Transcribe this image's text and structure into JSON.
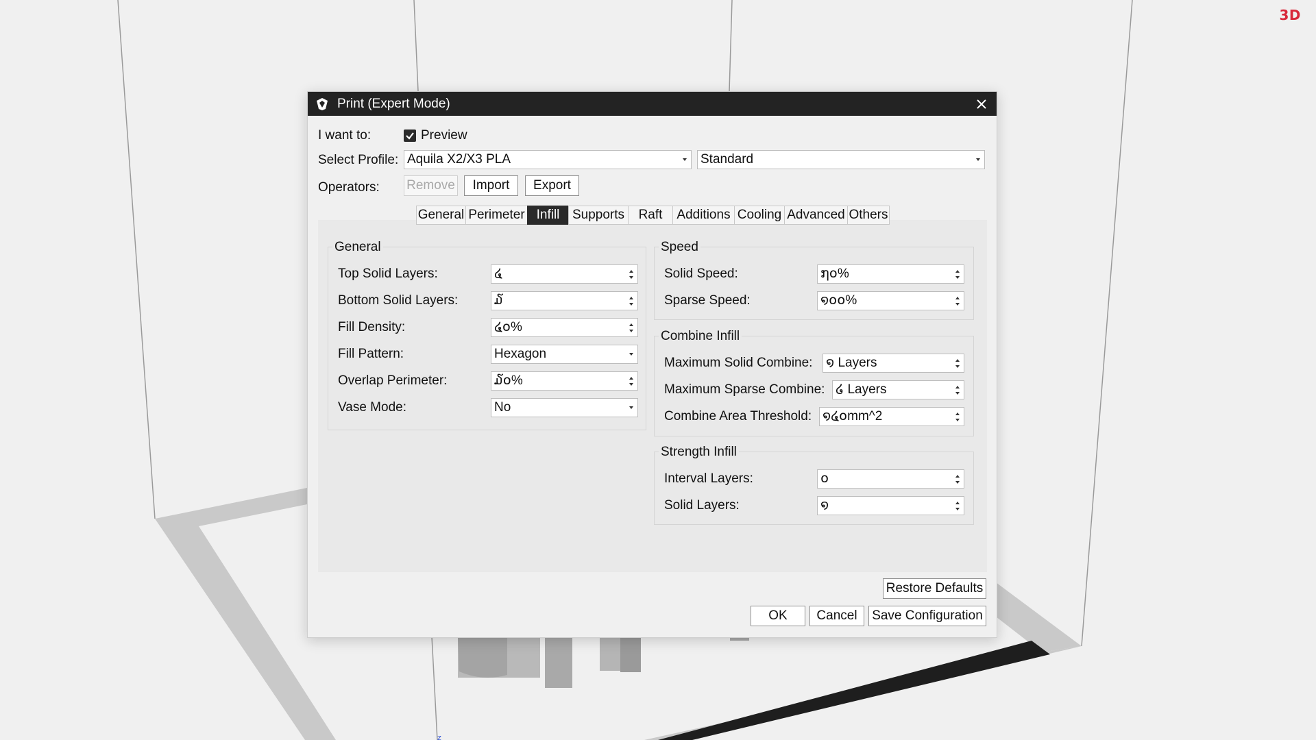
{
  "brand": "3D",
  "dialog": {
    "title": "Print (Expert Mode)",
    "i_want_to_label": "I want to:",
    "preview_label": "Preview",
    "preview_checked": true,
    "select_profile_label": "Select Profile:",
    "profile_value": "Aquila X2/X3 PLA",
    "quality_value": "Standard",
    "operators_label": "Operators:",
    "remove_label": "Remove",
    "import_label": "Import",
    "export_label": "Export",
    "tabs": [
      "General",
      "Perimeter",
      "Infill",
      "Supports",
      "Raft",
      "Additions",
      "Cooling",
      "Advanced",
      "Others"
    ],
    "active_tab": "Infill"
  },
  "general": {
    "title": "General",
    "top_solid_layers_label": "Top Solid Layers:",
    "top_solid_layers_value": "໔",
    "bottom_solid_layers_label": "Bottom Solid Layers:",
    "bottom_solid_layers_value": "໓",
    "fill_density_label": "Fill Density:",
    "fill_density_value": "໔໐%",
    "fill_pattern_label": "Fill Pattern:",
    "fill_pattern_value": "Hexagon",
    "overlap_perimeter_label": "Overlap Perimeter:",
    "overlap_perimeter_value": "໓໐%",
    "vase_mode_label": "Vase Mode:",
    "vase_mode_value": "No"
  },
  "speed": {
    "title": "Speed",
    "solid_speed_label": "Solid Speed:",
    "solid_speed_value": "໗໐%",
    "sparse_speed_label": "Sparse Speed:",
    "sparse_speed_value": "໑໐໐%"
  },
  "combine": {
    "title": "Combine Infill",
    "max_solid_label": "Maximum Solid Combine:",
    "max_solid_value": "໑ Layers",
    "max_sparse_label": "Maximum Sparse Combine:",
    "max_sparse_value": "໒ Layers",
    "area_threshold_label": "Combine Area Threshold:",
    "area_threshold_value": "໑໔໐mm^2"
  },
  "strength": {
    "title": "Strength Infill",
    "interval_label": "Interval Layers:",
    "interval_value": "໐",
    "solid_label": "Solid Layers:",
    "solid_value": "໑"
  },
  "footer": {
    "restore_label": "Restore Defaults",
    "ok_label": "OK",
    "cancel_label": "Cancel",
    "save_label": "Save Configuration"
  },
  "colors": {
    "titlebar": "#232323",
    "background": "#f0f0f0",
    "panel": "#e9e9e9",
    "brand": "#d8283a"
  }
}
